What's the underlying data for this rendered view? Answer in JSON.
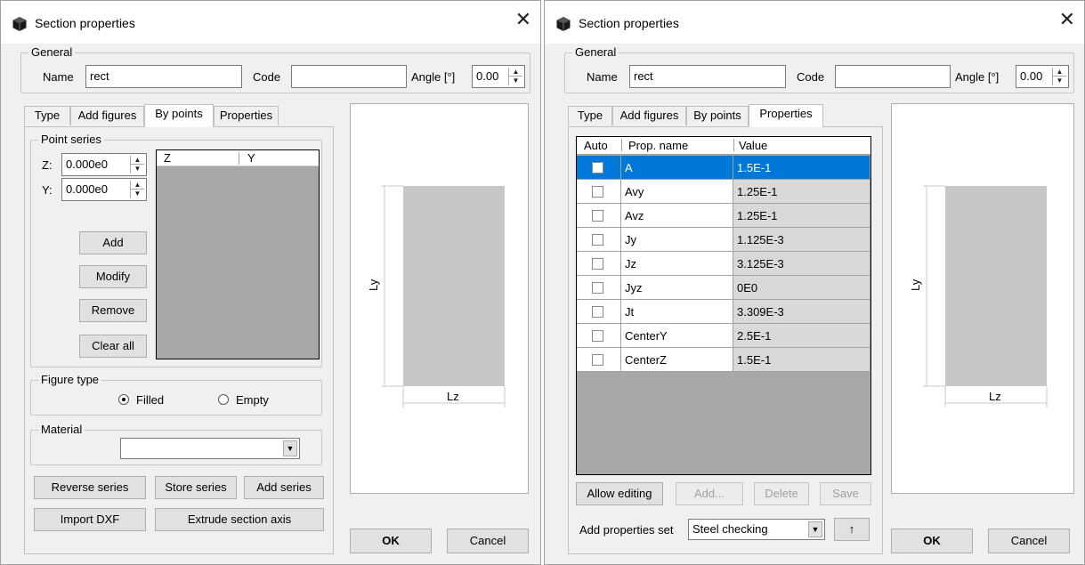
{
  "windows": [
    {
      "title": "Section properties",
      "general": {
        "group_label": "General",
        "name_label": "Name",
        "name_value": "rect",
        "code_label": "Code",
        "code_value": "",
        "angle_label": "Angle [°]",
        "angle_value": "0.00"
      },
      "tabs": [
        "Type",
        "Add figures",
        "By points",
        "Properties"
      ],
      "active_tab": "By points",
      "by_points": {
        "point_series_label": "Point series",
        "z_label": "Z:",
        "z_value": "0.000e0",
        "y_label": "Y:",
        "y_value": "0.000e0",
        "list_columns": [
          "Z",
          "Y"
        ],
        "add_label": "Add",
        "modify_label": "Modify",
        "remove_label": "Remove",
        "clear_all_label": "Clear all",
        "figure_type_label": "Figure type",
        "filled_label": "Filled",
        "empty_label": "Empty",
        "figure_type_selected": "Filled",
        "material_label": "Material",
        "material_value": "",
        "reverse_series_label": "Reverse series",
        "store_series_label": "Store series",
        "add_series_label": "Add series",
        "import_dxf_label": "Import DXF",
        "extrude_label": "Extrude section axis"
      },
      "preview": {
        "ly_label": "Ly",
        "lz_label": "Lz"
      },
      "ok_label": "OK",
      "cancel_label": "Cancel"
    },
    {
      "title": "Section properties",
      "general": {
        "group_label": "General",
        "name_label": "Name",
        "name_value": "rect",
        "code_label": "Code",
        "code_value": "",
        "angle_label": "Angle [°]",
        "angle_value": "0.00"
      },
      "tabs": [
        "Type",
        "Add figures",
        "By points",
        "Properties"
      ],
      "active_tab": "Properties",
      "properties": {
        "columns": [
          "Auto",
          "Prop. name",
          "Value"
        ],
        "rows": [
          {
            "name": "A",
            "value": "1.5E-1",
            "selected": true
          },
          {
            "name": "Avy",
            "value": "1.25E-1"
          },
          {
            "name": "Avz",
            "value": "1.25E-1"
          },
          {
            "name": "Jy",
            "value": "1.125E-3"
          },
          {
            "name": "Jz",
            "value": "3.125E-3"
          },
          {
            "name": "Jyz",
            "value": "0E0"
          },
          {
            "name": "Jt",
            "value": "3.309E-3"
          },
          {
            "name": "CenterY",
            "value": "2.5E-1"
          },
          {
            "name": "CenterZ",
            "value": "1.5E-1"
          }
        ],
        "allow_editing_label": "Allow editing",
        "add_label": "Add...",
        "delete_label": "Delete",
        "save_label": "Save",
        "add_properties_set_label": "Add properties set",
        "properties_set_value": "Steel checking",
        "up_label": "↑"
      },
      "preview": {
        "ly_label": "Ly",
        "lz_label": "Lz"
      },
      "ok_label": "OK",
      "cancel_label": "Cancel"
    }
  ]
}
